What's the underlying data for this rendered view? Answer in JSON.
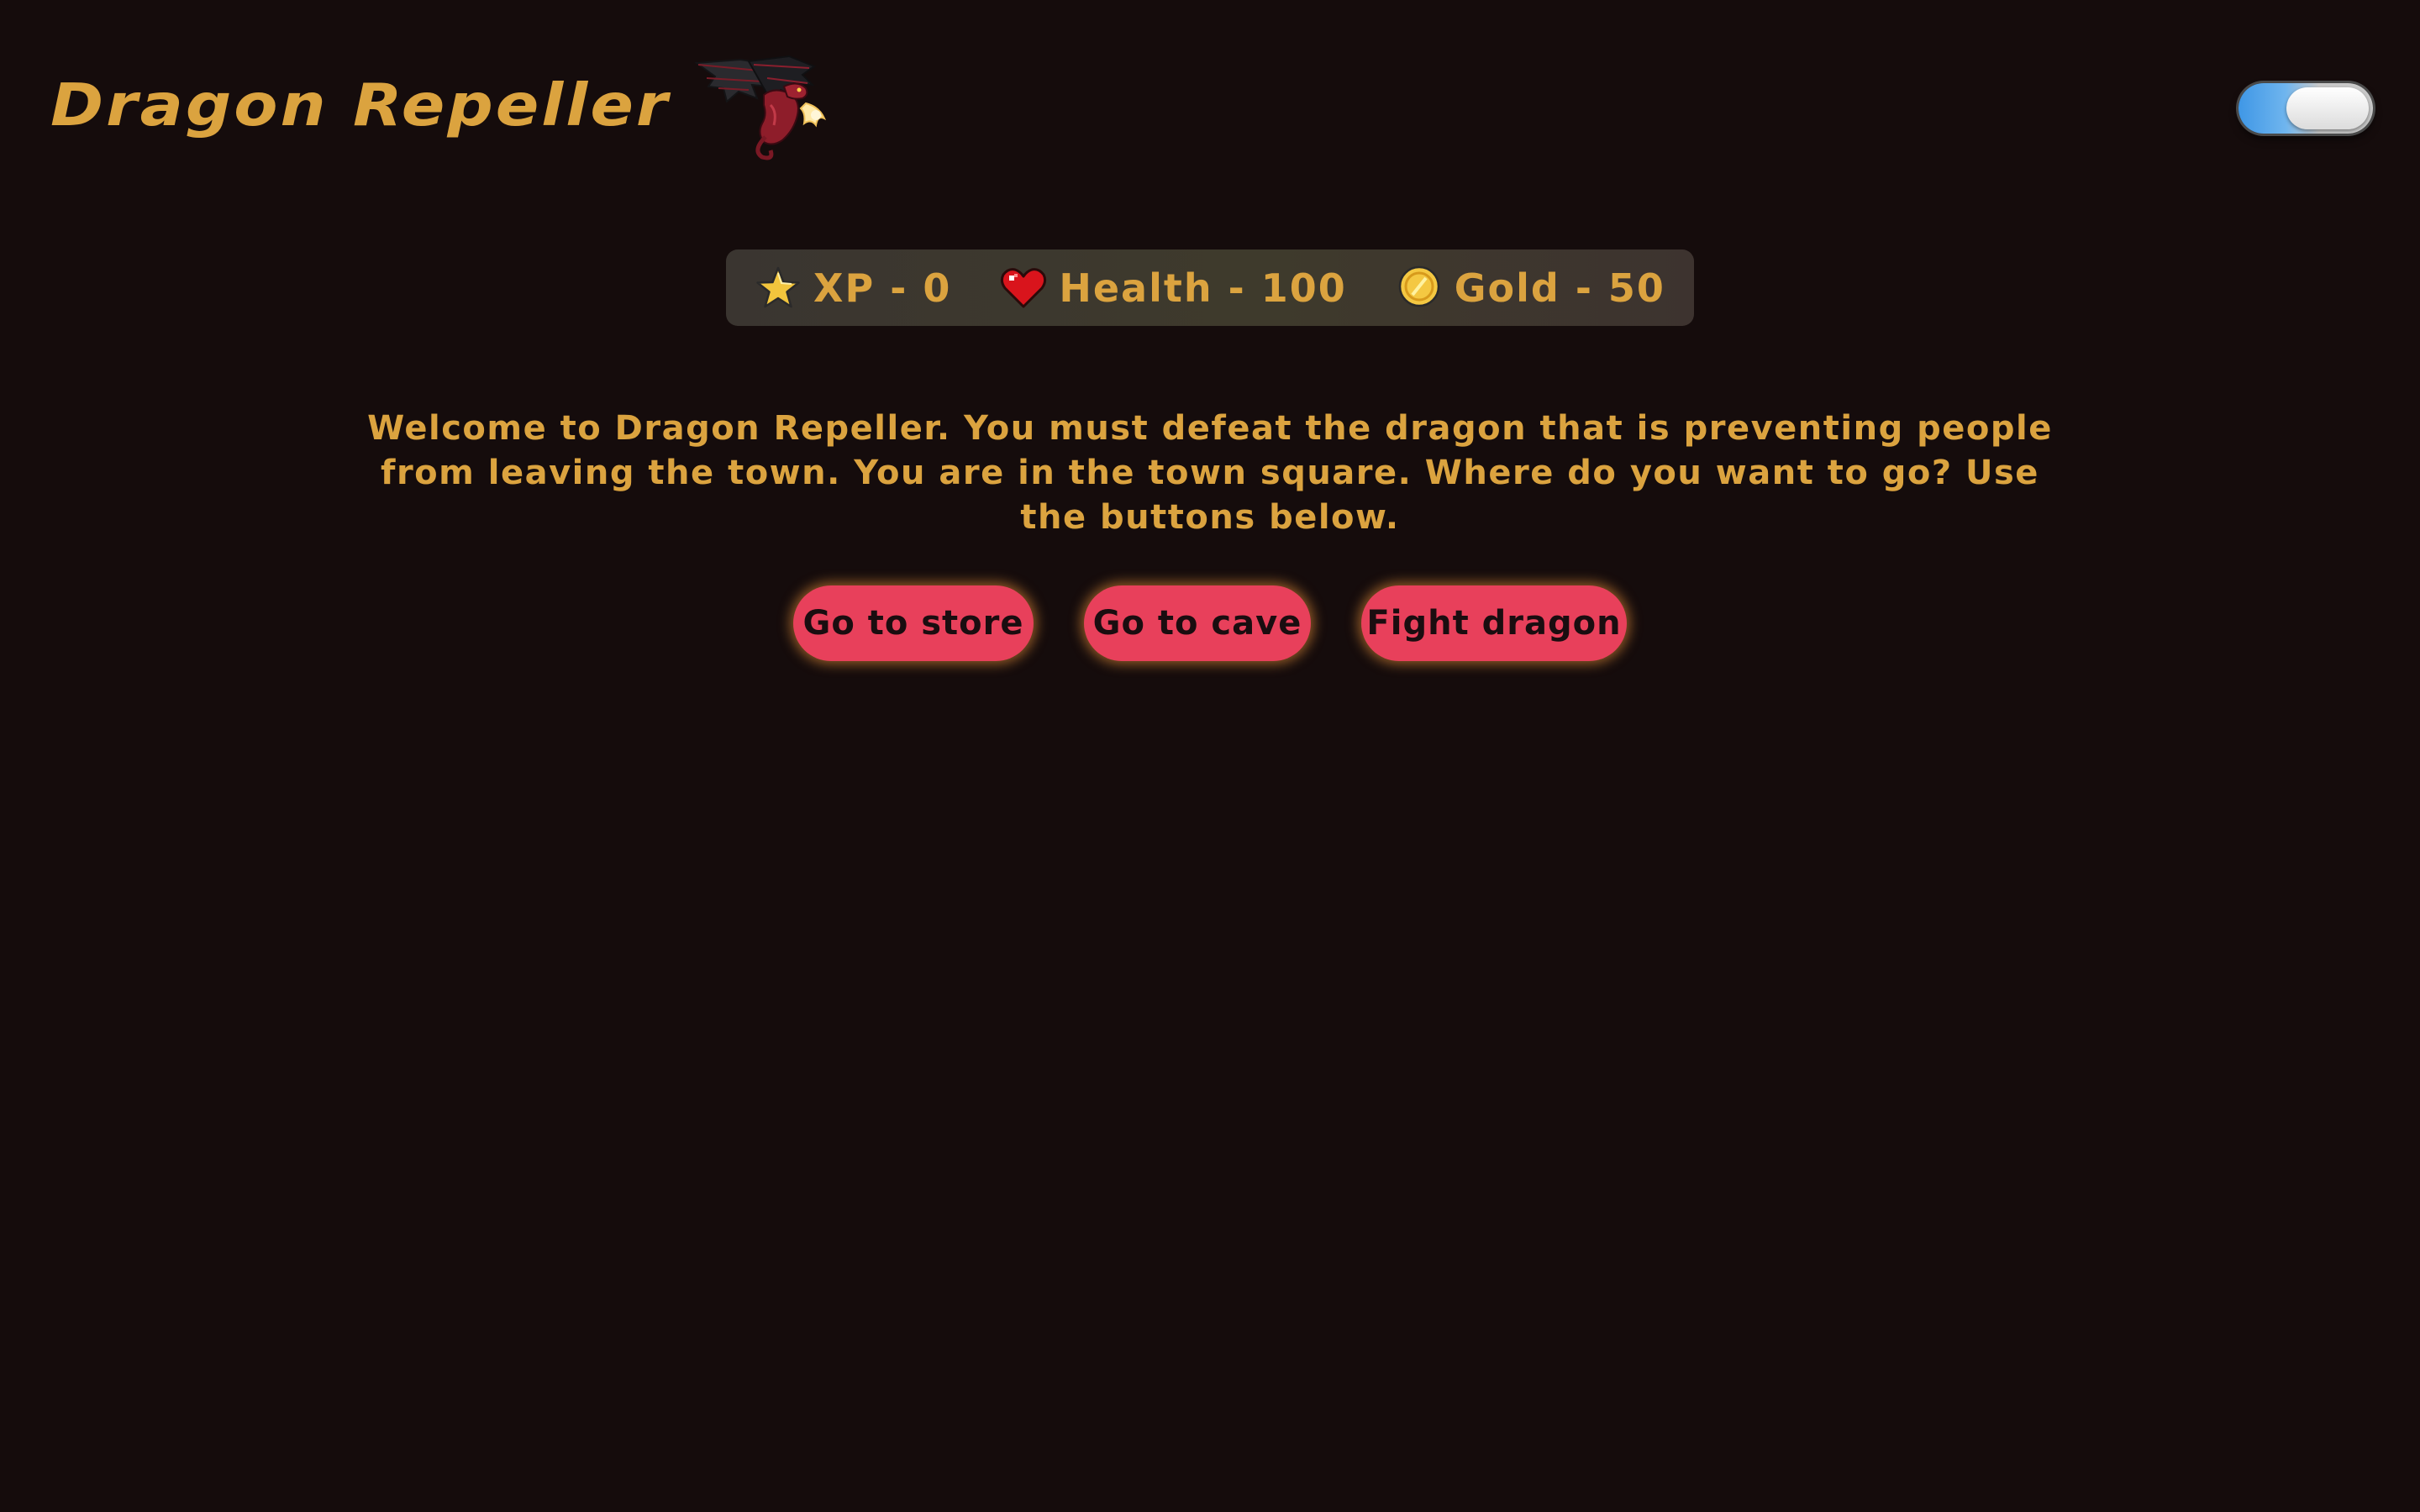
{
  "header": {
    "title": "Dragon Repeller",
    "logo_icon": "dragon-icon"
  },
  "theme_toggle": {
    "state": "on",
    "colors": {
      "track_on": "#3f97e6",
      "knob": "#ffffff"
    }
  },
  "stats": {
    "xp": {
      "label": "XP - 0",
      "icon": "star-icon"
    },
    "health": {
      "label": "Health - 100",
      "icon": "heart-icon"
    },
    "gold": {
      "label": "Gold - 50",
      "icon": "coin-icon"
    }
  },
  "message": "Welcome to Dragon Repeller. You must defeat the dragon that is preventing people from leaving the town. You are in the town square. Where do you want to go? Use the buttons below.",
  "controls": {
    "button1": "Go to store",
    "button2": "Go to cave",
    "button3": "Fight dragon"
  },
  "colors": {
    "background": "#150c0c",
    "text_gold": "#dba33f",
    "button": "#e8405b",
    "button_text": "#1a0d10"
  }
}
